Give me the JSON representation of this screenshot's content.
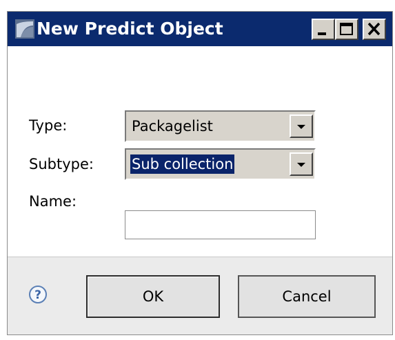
{
  "window": {
    "title": "New Predict Object",
    "controls": [
      "minimize",
      "maximize",
      "close"
    ]
  },
  "form": {
    "type_label": "Type:",
    "type_value": "Packagelist",
    "subtype_label": "Subtype:",
    "subtype_value": "Sub collection",
    "name_label": "Name:",
    "name_value": ""
  },
  "footer": {
    "help_icon": "help-icon",
    "ok_label": "OK",
    "cancel_label": "Cancel"
  },
  "colors": {
    "titlebar": "#0b2a6e",
    "selection": "#0a246a",
    "footer_bg": "#ebebeb"
  }
}
